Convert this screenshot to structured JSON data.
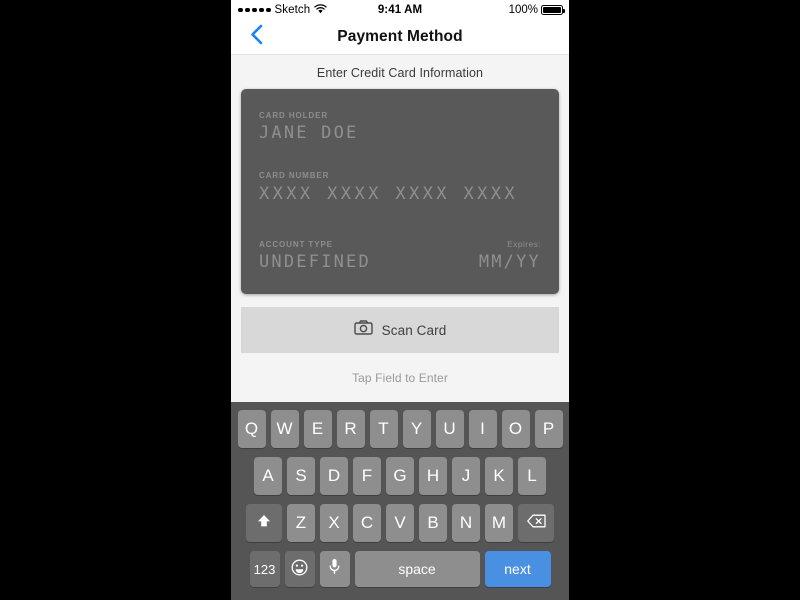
{
  "status_bar": {
    "signal_dots": 5,
    "carrier": "Sketch",
    "wifi_icon": "wifi-icon",
    "time": "9:41 AM",
    "battery_percent": "100%",
    "battery_icon": "battery-full-icon"
  },
  "nav_bar": {
    "back_icon": "chevron-left-icon",
    "title": "Payment Method",
    "accent_color": "#1a82f7"
  },
  "content": {
    "section_heading": "Enter Credit Card Information",
    "hint": "Tap Field to Enter",
    "background_color": "#f4f4f4"
  },
  "credit_card": {
    "background_color": "#595959",
    "holder_label": "CARD HOLDER",
    "holder_value": "JANE DOE",
    "number_label": "CARD NUMBER",
    "number_value": "XXXX XXXX XXXX XXXX",
    "account_type_label": "ACCOUNT TYPE",
    "account_type_value": "UNDEFINED",
    "expires_label": "Expires:",
    "expires_value": "MM/YY"
  },
  "scan_button": {
    "icon": "camera-icon",
    "label": "Scan Card",
    "background_color": "#d8d8d8"
  },
  "keyboard": {
    "background_color": "#555555",
    "key_color": "#8e8e8e",
    "row1": [
      "Q",
      "W",
      "E",
      "R",
      "T",
      "Y",
      "U",
      "I",
      "O",
      "P"
    ],
    "row2": [
      "A",
      "S",
      "D",
      "F",
      "G",
      "H",
      "J",
      "K",
      "L"
    ],
    "row3_letters": [
      "Z",
      "X",
      "C",
      "V",
      "B",
      "N",
      "M"
    ],
    "shift_icon": "shift-arrow-up-icon",
    "backspace_icon": "backspace-delete-icon",
    "numbers_key": "123",
    "emoji_icon": "emoji-smiley-icon",
    "mic_icon": "microphone-icon",
    "space_label": "space",
    "next_label": "next",
    "next_color": "#4a90e2"
  }
}
